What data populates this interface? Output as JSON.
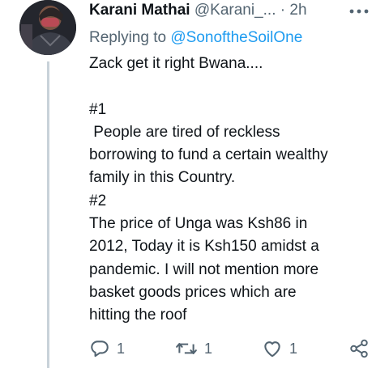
{
  "tweet": {
    "display_name": "Karani Mathai",
    "handle": "@Karani_...",
    "separator": "·",
    "time": "2h",
    "replying_label": "Replying to",
    "replying_to": "@SonoftheSoilOne",
    "lines": [
      "Zack get it right Bwana....",
      "",
      "#1",
      " People are tired of reckless",
      "borrowing to fund a certain wealthy",
      "family in this Country.",
      "#2",
      "The price of Unga was Ksh86 in",
      "2012, Today it is Ksh150 amidst a",
      "pandemic. I will not mention more",
      "basket goods prices which are",
      "hitting the roof"
    ]
  },
  "actions": {
    "reply_icon": "reply-icon",
    "reply_count": "1",
    "retweet_icon": "retweet-icon",
    "retweet_count": "1",
    "like_icon": "heart-icon",
    "like_count": "1",
    "share_icon": "share-icon"
  },
  "colors": {
    "text": "#0f1419",
    "secondary": "#536471",
    "link": "#1d9bf0",
    "thread_line": "#c8d2d9"
  }
}
